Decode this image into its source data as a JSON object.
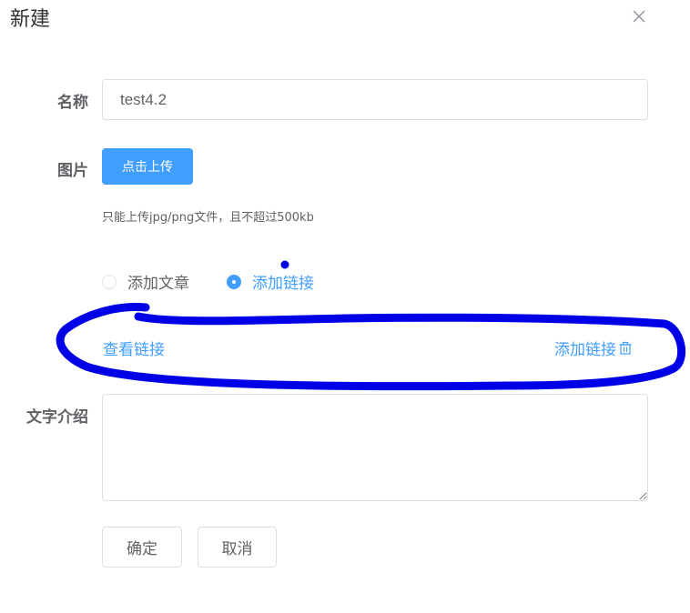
{
  "dialog": {
    "title": "新建",
    "close_icon": "close-icon"
  },
  "form": {
    "name": {
      "label": "名称",
      "value": "test4.2"
    },
    "image": {
      "label": "图片",
      "upload_button": "点击上传",
      "tip": "只能上传jpg/png文件，且不超过500kb"
    },
    "type_radio": {
      "options": [
        {
          "label": "添加文章",
          "checked": false
        },
        {
          "label": "添加链接",
          "checked": true
        }
      ]
    },
    "link": {
      "view_label": "查看链接",
      "add_label": "添加链接",
      "delete_icon": "trash-icon"
    },
    "intro": {
      "label": "文字介绍",
      "value": ""
    },
    "buttons": {
      "confirm": "确定",
      "cancel": "取消"
    }
  },
  "colors": {
    "primary": "#409eff",
    "annotation": "#0000e6"
  }
}
